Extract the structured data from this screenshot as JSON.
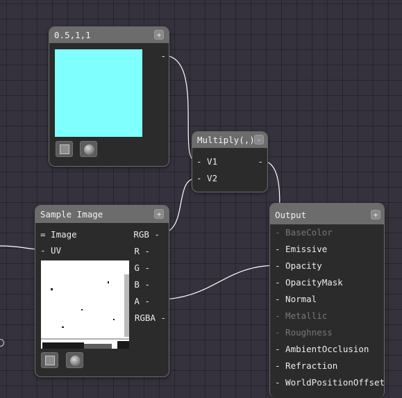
{
  "color_node": {
    "title": "0.5,1,1",
    "collapse_glyph": "+",
    "output_port": "-",
    "swatch_color": "#80ffff",
    "preview_buttons": [
      "square-preview-icon",
      "sphere-preview-icon"
    ]
  },
  "multiply_node": {
    "title": "Multiply(,)",
    "collapse_glyph": "-",
    "inputs": [
      "- V1",
      "- V2"
    ],
    "output_port": "-"
  },
  "sample_node": {
    "title": "Sample Image",
    "collapse_glyph": "+",
    "inputs": [
      "= Image",
      "- UV"
    ],
    "outputs": [
      "RGB -",
      "R -",
      "G -",
      "B -",
      "A -",
      "RGBA -"
    ],
    "preview_buttons": [
      "square-preview-icon",
      "sphere-preview-icon"
    ]
  },
  "output_node": {
    "title": "Output",
    "collapse_glyph": "+",
    "inputs": [
      {
        "label": "- BaseColor",
        "enabled": false
      },
      {
        "label": "- Emissive",
        "enabled": true
      },
      {
        "label": "- Opacity",
        "enabled": true
      },
      {
        "label": "- OpacityMask",
        "enabled": true
      },
      {
        "label": "- Normal",
        "enabled": true
      },
      {
        "label": "- Metallic",
        "enabled": false
      },
      {
        "label": "- Roughness",
        "enabled": false
      },
      {
        "label": "- AmbientOcclusion",
        "enabled": true
      },
      {
        "label": "- Refraction",
        "enabled": true
      },
      {
        "label": "- WorldPositionOffset",
        "enabled": true
      }
    ]
  },
  "colors": {
    "canvas_bg": "#35323d",
    "node_bg": "#2b2b2b",
    "node_header": "#6c6c6c",
    "wire": "#ffffff",
    "disabled_text": "#787878"
  }
}
